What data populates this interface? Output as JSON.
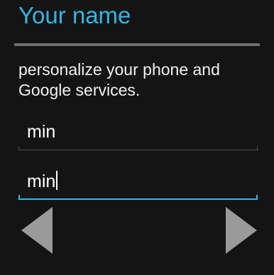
{
  "header": {
    "title": "Your name"
  },
  "description": "personalize your phone and Google services.",
  "form": {
    "first_name": {
      "value": "min"
    },
    "last_name": {
      "value": "min"
    }
  },
  "navigation": {
    "back_icon": "left-triangle-icon",
    "next_icon": "right-triangle-icon"
  },
  "colors": {
    "accent": "#33b5e5",
    "nav_arrow": "#9a9a9a"
  }
}
